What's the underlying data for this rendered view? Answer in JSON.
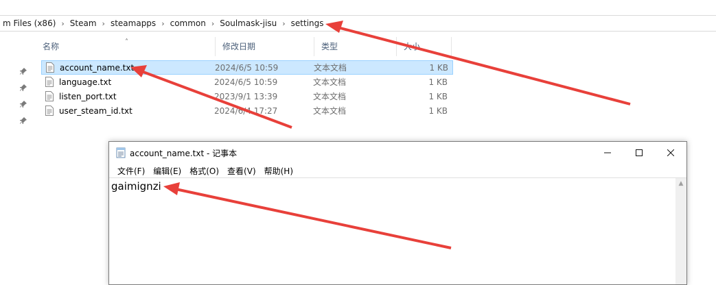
{
  "breadcrumbs": [
    "m Files (x86)",
    "Steam",
    "steamapps",
    "common",
    "Soulmask-jisu",
    "settings"
  ],
  "columns": {
    "name": "名称",
    "date": "修改日期",
    "type": "类型",
    "size": "大小"
  },
  "files": [
    {
      "name": "account_name.txt",
      "date": "2024/6/5 10:59",
      "type": "文本文档",
      "size": "1 KB",
      "selected": true
    },
    {
      "name": "language.txt",
      "date": "2024/6/5 10:59",
      "type": "文本文档",
      "size": "1 KB"
    },
    {
      "name": "listen_port.txt",
      "date": "2023/9/1 13:39",
      "type": "文本文档",
      "size": "1 KB"
    },
    {
      "name": "user_steam_id.txt",
      "date": "2024/6/4 17:27",
      "type": "文本文档",
      "size": "1 KB"
    }
  ],
  "notepad": {
    "title": "account_name.txt - 记事本",
    "menu": [
      "文件(F)",
      "编辑(E)",
      "格式(O)",
      "查看(V)",
      "帮助(H)"
    ],
    "content": "gaimignzi"
  },
  "colors": {
    "selection": "#cce8ff",
    "arrow": "#e8403a"
  },
  "icons": {
    "pins": [
      "pin-icon",
      "pin-icon",
      "pin-icon",
      "pin-icon"
    ]
  }
}
